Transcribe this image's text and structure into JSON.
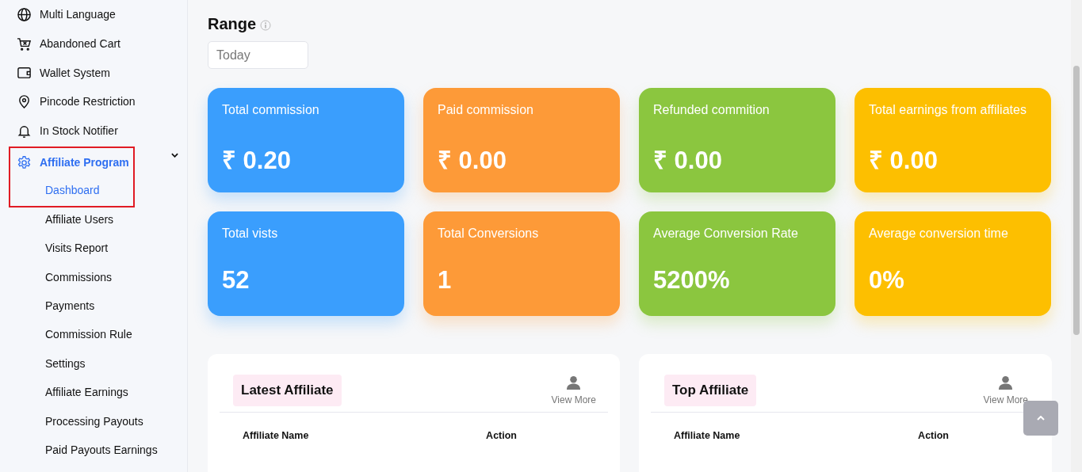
{
  "sidebar": {
    "items": [
      {
        "label": "Multi Language"
      },
      {
        "label": "Abandoned Cart"
      },
      {
        "label": "Wallet System"
      },
      {
        "label": "Pincode Restriction"
      },
      {
        "label": "In Stock Notifier"
      }
    ],
    "active_group": {
      "label": "Affiliate Program",
      "expanded": true,
      "highlighted": true,
      "children": [
        {
          "label": "Dashboard",
          "selected": true
        },
        {
          "label": "Affiliate Users",
          "selected": false
        },
        {
          "label": "Visits Report",
          "selected": false
        },
        {
          "label": "Commissions",
          "selected": false
        },
        {
          "label": "Payments",
          "selected": false
        },
        {
          "label": "Commission Rule",
          "selected": false
        },
        {
          "label": "Settings",
          "selected": false
        },
        {
          "label": "Affiliate Earnings",
          "selected": false
        },
        {
          "label": "Processing Payouts",
          "selected": false
        },
        {
          "label": "Paid Payouts Earnings",
          "selected": false
        }
      ]
    }
  },
  "range": {
    "title": "Range",
    "placeholder": "Today"
  },
  "stats": [
    {
      "label": "Total commission",
      "value": "₹ 0.20",
      "color": "#3a9efd"
    },
    {
      "label": "Paid commission",
      "value": "₹ 0.00",
      "color": "#fd9a38"
    },
    {
      "label": "Refunded commition",
      "value": "₹ 0.00",
      "color": "#8bc63f"
    },
    {
      "label": "Total earnings from affiliates",
      "value": "₹ 0.00",
      "color": "#fdbf00"
    },
    {
      "label": "Total vists",
      "value": "52",
      "color": "#3a9efd"
    },
    {
      "label": "Total Conversions",
      "value": "1",
      "color": "#fd9a38"
    },
    {
      "label": "Average Conversion Rate",
      "value": "5200%",
      "color": "#8bc63f"
    },
    {
      "label": "Average conversion time",
      "value": "0%",
      "color": "#fdbf00"
    }
  ],
  "panels": [
    {
      "title": "Latest Affiliate",
      "link": "View More",
      "columns": [
        "Affiliate Name",
        "Action"
      ]
    },
    {
      "title": "Top Affiliate",
      "link": "View More",
      "columns": [
        "Affiliate Name",
        "Action"
      ]
    }
  ]
}
